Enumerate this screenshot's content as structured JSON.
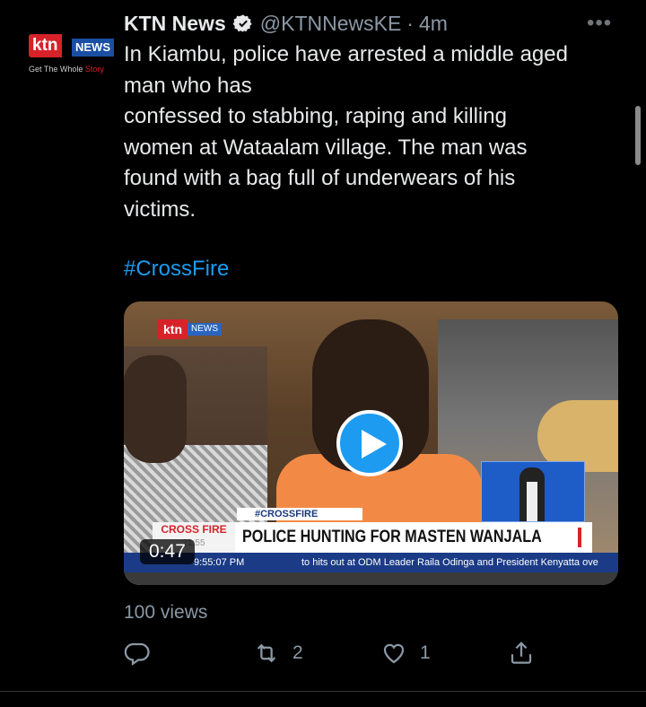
{
  "avatar": {
    "logo_ktn": "ktn",
    "logo_news": "NEWS",
    "tagline_prefix": "Get The Whole ",
    "tagline_suffix": "Story"
  },
  "tweet": {
    "display_name": "KTN News",
    "handle": "@KTNNewsKE",
    "separator": "·",
    "time": "4m",
    "more": "•••",
    "lines": [
      "In Kiambu, police have arrested a middle aged",
      "man who has",
      "confessed to stabbing, raping and killing",
      "women at Wataalam village. The man was",
      "found with a bag full of underwears of his",
      "victims."
    ],
    "hashtag": "#CrossFire"
  },
  "media": {
    "channel_logo": "ktn",
    "channel_sub": "NEWS",
    "strap": "#CROSSFIRE",
    "show_name": "CROSS FIRE",
    "show_time": "21:55",
    "headline": "POLICE HUNTING FOR MASTEN WANJALA",
    "ticker_time": "9:55:07 PM",
    "ticker_text": "to hits out at ODM Leader Raila Odinga and President Kenyatta ove",
    "duration": "0:47"
  },
  "stats": {
    "views": "100 views",
    "retweets": "2",
    "likes": "1"
  },
  "icons": {
    "reply": "reply-icon",
    "retweet": "retweet-icon",
    "like": "heart-icon",
    "share": "share-icon",
    "verified": "verified-badge-icon",
    "play": "play-icon"
  },
  "colors": {
    "background": "#000000",
    "text": "#e7e9ea",
    "muted": "#8b98a5",
    "link": "#1d9bf0",
    "brand_red": "#d8222a"
  }
}
